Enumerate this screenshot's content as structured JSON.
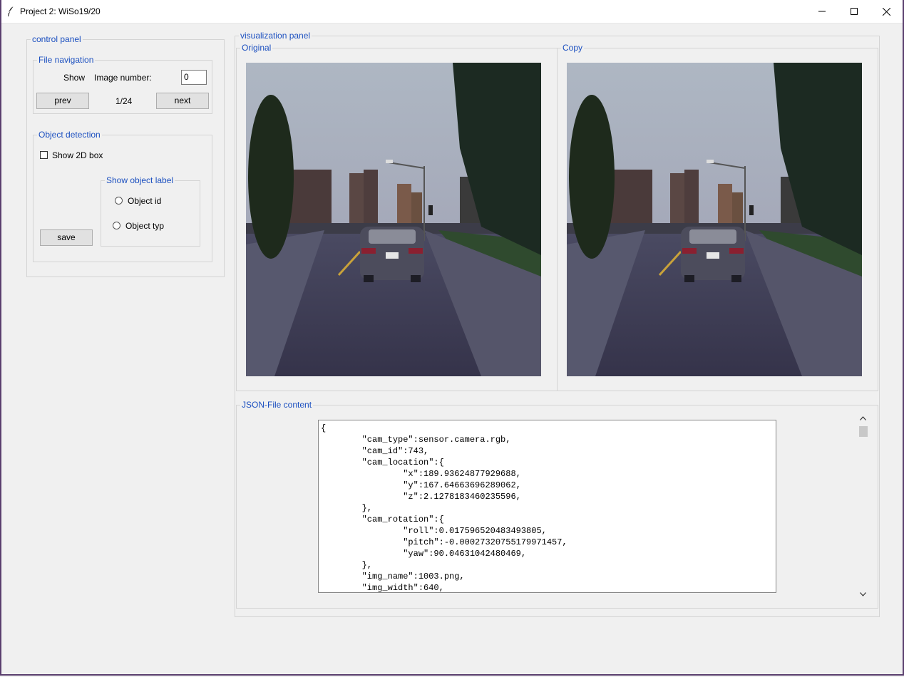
{
  "window": {
    "title": "Project 2: WiSo19/20"
  },
  "control_panel": {
    "title": "control panel",
    "file_navigation": {
      "title": "File navigation",
      "show_label": "Show",
      "image_number_label": "Image number:",
      "image_number_value": "0",
      "prev_label": "prev",
      "counter": "1/24",
      "next_label": "next"
    },
    "object_detection": {
      "title": "Object detection",
      "show_2d_box_label": "Show 2D box",
      "show_2d_box_checked": false,
      "object_label_group": {
        "title": "Show object label",
        "options": [
          "Object id",
          "Object typ"
        ]
      },
      "save_label": "save"
    }
  },
  "visualization_panel": {
    "title": "visualization panel",
    "original_title": "Original",
    "copy_title": "Copy",
    "json_title": "JSON-File content",
    "json_text": "{\n        \"cam_type\":sensor.camera.rgb,\n        \"cam_id\":743,\n        \"cam_location\":{\n                \"x\":189.93624877929688,\n                \"y\":167.64663696289062,\n                \"z\":2.1278183460235596,\n        },\n        \"cam_rotation\":{\n                \"roll\":0.017596520483493805,\n                \"pitch\":-0.00027320755179971457,\n                \"yaw\":90.04631042480469,\n        },\n        \"img_name\":1003.png,\n        \"img_width\":640,"
  },
  "icons": {
    "app": "feather-icon",
    "minimize": "minimize-icon",
    "maximize": "maximize-icon",
    "close": "close-icon",
    "scroll_up": "chevron-up-icon",
    "scroll_down": "chevron-down-icon"
  },
  "colors": {
    "group_label": "#1c50c0",
    "window_border": "#5a3f6e",
    "sky": "#a9b1bd",
    "road": "#3b3a52"
  }
}
